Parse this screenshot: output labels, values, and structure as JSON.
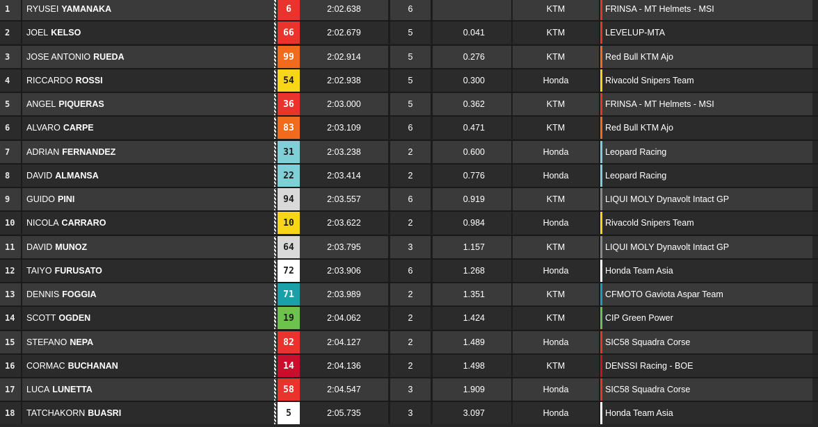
{
  "colors": {
    "row_light": "#3a3a3a",
    "row_dark": "#2b2b2b",
    "text": "#ffffff"
  },
  "rows": [
    {
      "pos": "1",
      "first": "RYUSEI",
      "last": "YAMANAKA",
      "num": "6",
      "num_bg": "#e8342d",
      "num_fg": "#ffffff",
      "time": "2:02.638",
      "laps": "6",
      "gap": "",
      "bike": "KTM",
      "team": "FRINSA - MT Helmets - MSI",
      "team_color": "#e8342d"
    },
    {
      "pos": "2",
      "first": "JOEL",
      "last": "KELSO",
      "num": "66",
      "num_bg": "#e8342d",
      "num_fg": "#ffffff",
      "time": "2:02.679",
      "laps": "5",
      "gap": "0.041",
      "bike": "KTM",
      "team": "LEVELUP-MTA",
      "team_color": "#e8342d"
    },
    {
      "pos": "3",
      "first": "JOSE ANTONIO",
      "last": "RUEDA",
      "num": "99",
      "num_bg": "#f26a1b",
      "num_fg": "#ffffff",
      "time": "2:02.914",
      "laps": "5",
      "gap": "0.276",
      "bike": "KTM",
      "team": "Red Bull KTM Ajo",
      "team_color": "#f26a1b"
    },
    {
      "pos": "4",
      "first": "RICCARDO",
      "last": "ROSSI",
      "num": "54",
      "num_bg": "#f7d61a",
      "num_fg": "#1a1a1a",
      "time": "2:02.938",
      "laps": "5",
      "gap": "0.300",
      "bike": "Honda",
      "team": "Rivacold Snipers Team",
      "team_color": "#f7d61a"
    },
    {
      "pos": "5",
      "first": "ANGEL",
      "last": "PIQUERAS",
      "num": "36",
      "num_bg": "#e8342d",
      "num_fg": "#ffffff",
      "time": "2:03.000",
      "laps": "5",
      "gap": "0.362",
      "bike": "KTM",
      "team": "FRINSA - MT Helmets - MSI",
      "team_color": "#e8342d"
    },
    {
      "pos": "6",
      "first": "ALVARO",
      "last": "CARPE",
      "num": "83",
      "num_bg": "#f26a1b",
      "num_fg": "#ffffff",
      "time": "2:03.109",
      "laps": "6",
      "gap": "0.471",
      "bike": "KTM",
      "team": "Red Bull KTM Ajo",
      "team_color": "#f26a1b"
    },
    {
      "pos": "7",
      "first": "ADRIAN",
      "last": "FERNANDEZ",
      "num": "31",
      "num_bg": "#7fd0d6",
      "num_fg": "#1a1a1a",
      "time": "2:03.238",
      "laps": "2",
      "gap": "0.600",
      "bike": "Honda",
      "team": "Leopard Racing",
      "team_color": "#7fd0d6"
    },
    {
      "pos": "8",
      "first": "DAVID",
      "last": "ALMANSA",
      "num": "22",
      "num_bg": "#7fd0d6",
      "num_fg": "#1a1a1a",
      "time": "2:03.414",
      "laps": "2",
      "gap": "0.776",
      "bike": "Honda",
      "team": "Leopard Racing",
      "team_color": "#7fd0d6"
    },
    {
      "pos": "9",
      "first": "GUIDO",
      "last": "PINI",
      "num": "94",
      "num_bg": "#d9d9d9",
      "num_fg": "#1a1a1a",
      "time": "2:03.557",
      "laps": "6",
      "gap": "0.919",
      "bike": "KTM",
      "team": "LIQUI MOLY Dynavolt Intact GP",
      "team_color": "#8a8a8a"
    },
    {
      "pos": "10",
      "first": "NICOLA",
      "last": "CARRARO",
      "num": "10",
      "num_bg": "#f7d61a",
      "num_fg": "#1a1a1a",
      "time": "2:03.622",
      "laps": "2",
      "gap": "0.984",
      "bike": "Honda",
      "team": "Rivacold Snipers Team",
      "team_color": "#f7d61a"
    },
    {
      "pos": "11",
      "first": "DAVID",
      "last": "MUNOZ",
      "num": "64",
      "num_bg": "#d9d9d9",
      "num_fg": "#1a1a1a",
      "time": "2:03.795",
      "laps": "3",
      "gap": "1.157",
      "bike": "KTM",
      "team": "LIQUI MOLY Dynavolt Intact GP",
      "team_color": "#8a8a8a"
    },
    {
      "pos": "12",
      "first": "TAIYO",
      "last": "FURUSATO",
      "num": "72",
      "num_bg": "#ffffff",
      "num_fg": "#1a1a1a",
      "time": "2:03.906",
      "laps": "6",
      "gap": "1.268",
      "bike": "Honda",
      "team": "Honda Team Asia",
      "team_color": "#ffffff"
    },
    {
      "pos": "13",
      "first": "DENNIS",
      "last": "FOGGIA",
      "num": "71",
      "num_bg": "#1aa0a8",
      "num_fg": "#ffffff",
      "time": "2:03.989",
      "laps": "2",
      "gap": "1.351",
      "bike": "KTM",
      "team": "CFMOTO Gaviota Aspar Team",
      "team_color": "#1aa0a8"
    },
    {
      "pos": "14",
      "first": "SCOTT",
      "last": "OGDEN",
      "num": "19",
      "num_bg": "#6cc24a",
      "num_fg": "#1a1a1a",
      "time": "2:04.062",
      "laps": "2",
      "gap": "1.424",
      "bike": "KTM",
      "team": "CIP Green Power",
      "team_color": "#6cc24a"
    },
    {
      "pos": "15",
      "first": "STEFANO",
      "last": "NEPA",
      "num": "82",
      "num_bg": "#e8342d",
      "num_fg": "#ffffff",
      "time": "2:04.127",
      "laps": "2",
      "gap": "1.489",
      "bike": "Honda",
      "team": "SIC58 Squadra Corse",
      "team_color": "#e8342d"
    },
    {
      "pos": "16",
      "first": "CORMAC",
      "last": "BUCHANAN",
      "num": "14",
      "num_bg": "#c8102e",
      "num_fg": "#ffffff",
      "time": "2:04.136",
      "laps": "2",
      "gap": "1.498",
      "bike": "KTM",
      "team": "DENSSI Racing - BOE",
      "team_color": "#c8102e"
    },
    {
      "pos": "17",
      "first": "LUCA",
      "last": "LUNETTA",
      "num": "58",
      "num_bg": "#e8342d",
      "num_fg": "#ffffff",
      "time": "2:04.547",
      "laps": "3",
      "gap": "1.909",
      "bike": "Honda",
      "team": "SIC58 Squadra Corse",
      "team_color": "#e8342d"
    },
    {
      "pos": "18",
      "first": "TATCHAKORN",
      "last": "BUASRI",
      "num": "5",
      "num_bg": "#ffffff",
      "num_fg": "#1a1a1a",
      "time": "2:05.735",
      "laps": "3",
      "gap": "3.097",
      "bike": "Honda",
      "team": "Honda Team Asia",
      "team_color": "#ffffff"
    }
  ]
}
